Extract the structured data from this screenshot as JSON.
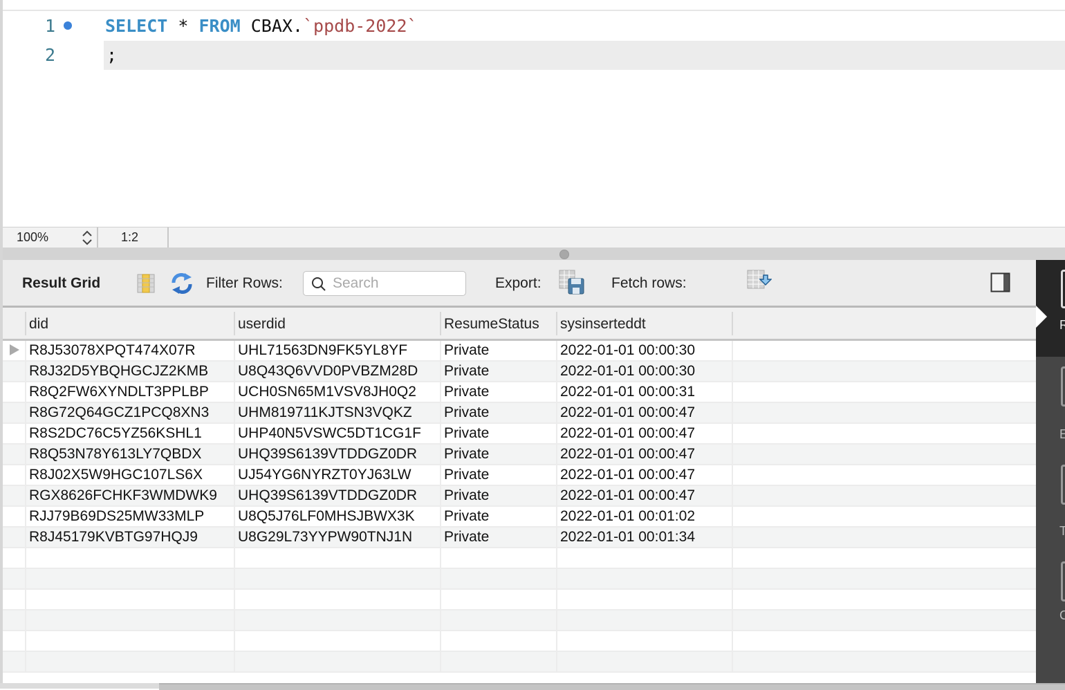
{
  "editor": {
    "lines": [
      {
        "number": "1",
        "has_breakpoint_dot": true,
        "tokens": {
          "kw1": "SELECT",
          "op": " * ",
          "kw2": "FROM",
          "ident": " CBAX.",
          "str": "`ppdb-2022`"
        }
      },
      {
        "number": "2",
        "text": ";"
      }
    ]
  },
  "statusbar": {
    "zoom": "100%",
    "cursor_position": "1:2"
  },
  "toolbar": {
    "result_grid_label": "Result Grid",
    "filter_rows_label": "Filter Rows:",
    "search_placeholder": "Search",
    "search_value": "",
    "export_label": "Export:",
    "fetch_rows_label": "Fetch rows:"
  },
  "grid": {
    "columns": [
      "did",
      "userdid",
      "ResumeStatus",
      "sysinserteddt"
    ],
    "rows": [
      [
        "R8J53078XPQT474X07R",
        "UHL71563DN9FK5YL8YF",
        "Private",
        "2022-01-01 00:00:30"
      ],
      [
        "R8J32D5YBQHGCJZ2KMB",
        "U8Q43Q6VVD0PVBZM28D",
        "Private",
        "2022-01-01 00:00:30"
      ],
      [
        "R8Q2FW6XYNDLT3PPLBP",
        "UCH0SN65M1VSV8JH0Q2",
        "Private",
        "2022-01-01 00:00:31"
      ],
      [
        "R8G72Q64GCZ1PCQ8XN3",
        "UHM819711KJTSN3VQKZ",
        "Private",
        "2022-01-01 00:00:47"
      ],
      [
        "R8S2DC76C5YZ56KSHL1",
        "UHP40N5VSWC5DT1CG1F",
        "Private",
        "2022-01-01 00:00:47"
      ],
      [
        "R8Q53N78Y613LY7QBDX",
        "UHQ39S6139VTDDGZ0DR",
        "Private",
        "2022-01-01 00:00:47"
      ],
      [
        "R8J02X5W9HGC107LS6X",
        "UJ54YG6NYRZT0YJ63LW",
        "Private",
        "2022-01-01 00:00:47"
      ],
      [
        "RGX8626FCHKF3WMDWK9",
        "UHQ39S6139VTDDGZ0DR",
        "Private",
        "2022-01-01 00:00:47"
      ],
      [
        "RJJ79B69DS25MW33MLP",
        "U8Q5J76LF0MHSJBWX3K",
        "Private",
        "2022-01-01 00:01:02"
      ],
      [
        "R8J45179KVBTG97HQJ9",
        "U8G29L73YYPW90TNJ1N",
        "Private",
        "2022-01-01 00:01:34"
      ]
    ],
    "empty_rows": 6,
    "selected_row": 0
  },
  "side_panel": {
    "letters": [
      "R",
      "E",
      "T",
      "C"
    ]
  },
  "colors": {
    "keyword": "#3a8ec6",
    "string": "#a64a4a",
    "line_number": "#3c7a8e",
    "breakpoint_dot": "#3b82d9",
    "side_panel_dark": "#262626",
    "side_panel": "#464646"
  }
}
